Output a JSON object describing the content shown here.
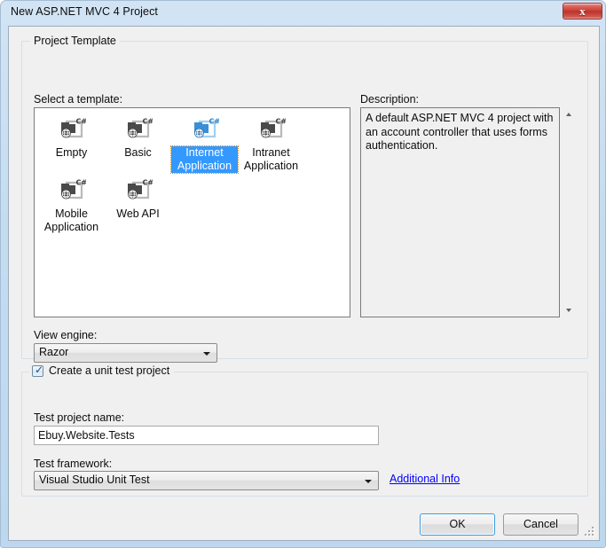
{
  "window": {
    "title": "New ASP.NET MVC 4 Project",
    "close_glyph": "x"
  },
  "project_template_group": {
    "caption": "Project Template",
    "select_template_label": "Select a template:",
    "description_label": "Description:",
    "description_text": "A default ASP.NET MVC 4 project with an account controller that uses forms authentication.",
    "templates": [
      {
        "label": "Empty",
        "selected": false
      },
      {
        "label": "Basic",
        "selected": false
      },
      {
        "label": "Internet Application",
        "selected": true
      },
      {
        "label": "Intranet Application",
        "selected": false
      },
      {
        "label": "Mobile Application",
        "selected": false
      },
      {
        "label": "Web API",
        "selected": false
      }
    ],
    "view_engine_label": "View engine:",
    "view_engine_value": "Razor"
  },
  "unit_test_group": {
    "checkbox_label": "Create a unit test project",
    "checkbox_checked": true,
    "check_glyph": "✓",
    "test_project_name_label": "Test project name:",
    "test_project_name_value": "Ebuy.Website.Tests",
    "test_framework_label": "Test framework:",
    "test_framework_value": "Visual Studio Unit Test",
    "additional_info_link": "Additional Info"
  },
  "buttons": {
    "ok": "OK",
    "cancel": "Cancel"
  },
  "colors": {
    "selection_blue": "#3399ff",
    "link_blue": "#0000ff",
    "focus_border": "#3c9ade",
    "title_bar_top": "#d2e4f4",
    "dialog_background": "#f0f0f0"
  }
}
